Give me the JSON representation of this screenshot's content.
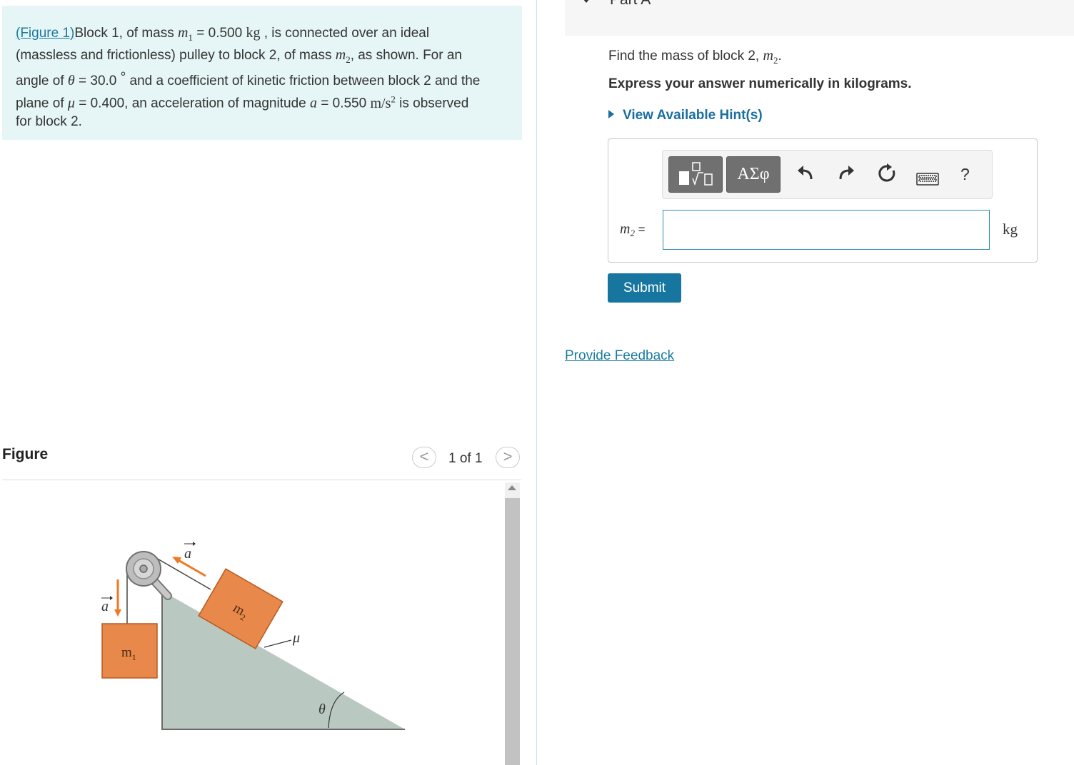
{
  "problem": {
    "figure_link": "(Figure 1)",
    "line1_a": "Block 1, of mass ",
    "m1_sym": "m",
    "m1_sub": "1",
    "line1_b": " = 0.500 ",
    "kg_unit": "kg",
    "line1_c": " , is connected over an ideal",
    "line2_a": "(massless and frictionless) pulley to block 2, of mass ",
    "m2_sym": "m",
    "m2_sub": "2",
    "line2_b": ", as shown. For an",
    "line3_a": "angle of ",
    "theta_sym": "θ",
    "line3_b": " = 30.0 ",
    "degree": "°",
    "line3_c": " and a coefficient of kinetic friction between block 2 and the",
    "line4_a": "plane of ",
    "mu_sym": "μ",
    "line4_b": " = 0.400, an acceleration of magnitude ",
    "a_sym": "a",
    "line4_c": " = 0.550 ",
    "accel_unit": "m/s",
    "accel_exp": "2",
    "line4_d": " is observed",
    "line5": "for block 2."
  },
  "figure_panel": {
    "title": "Figure",
    "pager_prev": "<",
    "pager_text": "1 of 1",
    "pager_next": ">",
    "labels": {
      "a1": "a",
      "a2": "a",
      "m1": "m",
      "m1_sub": "1",
      "m2": "m",
      "m2_sub": "2",
      "mu": "μ",
      "theta": "θ"
    },
    "colors": {
      "block": "#e8884a",
      "block_edge": "#b85a1e",
      "arrow": "#f07820",
      "incline": "#b9c9c1",
      "pulley": "#bdbdbd"
    }
  },
  "part": {
    "title": "Part A",
    "question_text": "Find the mass of block 2, ",
    "question_sym": "m",
    "question_sub": "2",
    "question_end": ".",
    "instruction": "Express your answer numerically in kilograms.",
    "hint_label": "View Available Hint(s)",
    "toolbar": {
      "symbols_label": "ΑΣφ",
      "help_label": "?",
      "icons": [
        "templates-icon",
        "undo-icon",
        "redo-icon",
        "reset-icon",
        "keyboard-icon",
        "help-icon"
      ]
    },
    "var_sym": "m",
    "var_sub": "2",
    "var_eq": " =",
    "input_value": "",
    "unit": "kg",
    "submit_label": "Submit",
    "feedback_label": "Provide Feedback"
  },
  "colors": {
    "problem_bg": "#e6f5f5",
    "link": "#1a7aa0",
    "submit_bg": "#1776a0",
    "toolbar_btn": "#707070"
  }
}
